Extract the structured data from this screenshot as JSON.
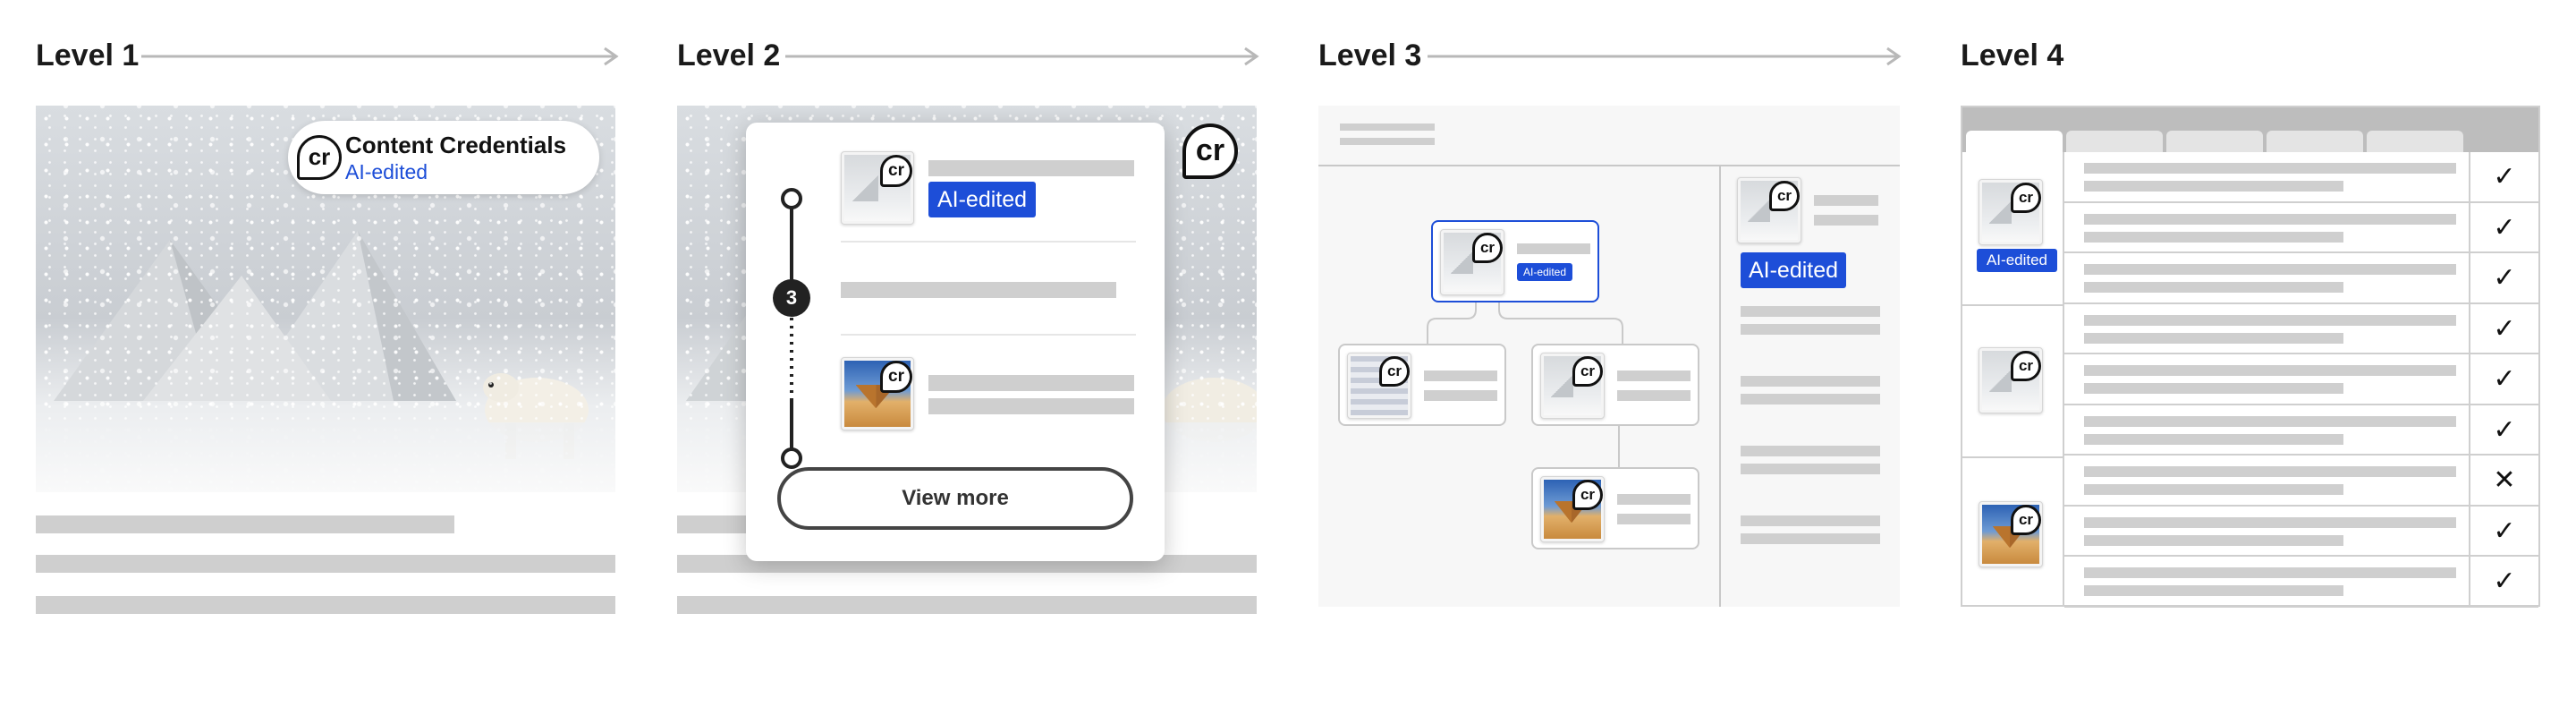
{
  "levels": [
    {
      "title": "Level 1"
    },
    {
      "title": "Level 2"
    },
    {
      "title": "Level 3"
    },
    {
      "title": "Level 4"
    }
  ],
  "level1": {
    "badge_title": "Content Credentials",
    "badge_subtitle": "AI-edited",
    "badge_icon": "cr-icon"
  },
  "level2": {
    "tag": "AI-edited",
    "step_count": "3",
    "view_more": "View more",
    "corner_icon": "cr-icon"
  },
  "level3": {
    "node_tag": "AI-edited",
    "side_tag": "AI-edited"
  },
  "level4": {
    "tag": "AI-edited",
    "rows": [
      "check",
      "check",
      "check",
      "check",
      "check",
      "check",
      "cross",
      "check",
      "check"
    ]
  },
  "cr_label": "cr",
  "colors": {
    "accent": "#1d4ed8",
    "placeholder": "#cfcfcf",
    "arrow": "#b8b8b8"
  }
}
